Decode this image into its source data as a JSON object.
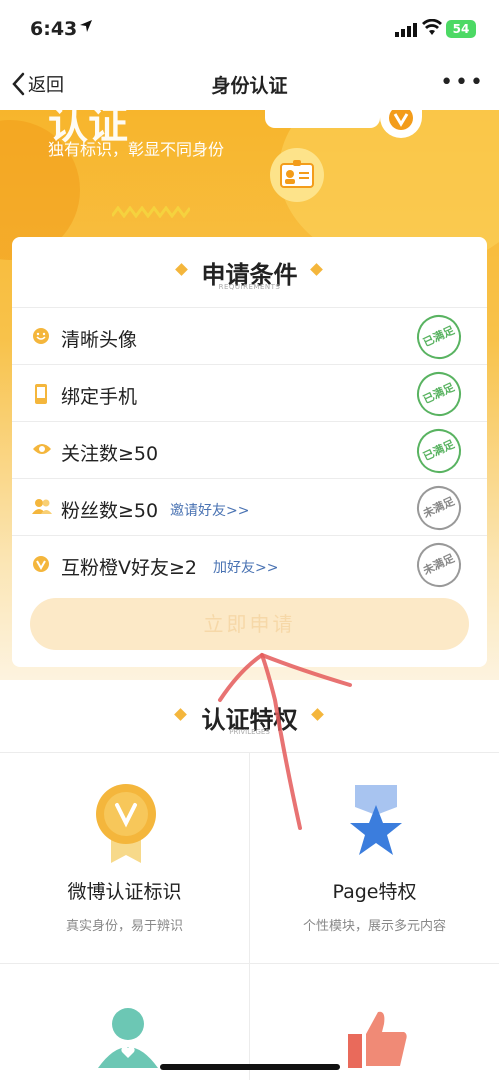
{
  "status": {
    "time": "6:43",
    "battery": "54"
  },
  "nav": {
    "back_label": "返回",
    "title": "身份认证"
  },
  "hero": {
    "big_text": "认证",
    "subtitle": "独有标识，彰显不同身份"
  },
  "conditions": {
    "title": "申请条件",
    "subtitle": "REQUIREMENTS",
    "rows": [
      {
        "label": "清晰头像",
        "link": "",
        "status": "已满足",
        "icon": "smile-icon"
      },
      {
        "label": "绑定手机",
        "link": "",
        "status": "已满足",
        "icon": "phone-icon"
      },
      {
        "label": "关注数≥50",
        "link": "",
        "status": "已满足",
        "icon": "eye-icon"
      },
      {
        "label": "粉丝数≥50",
        "link": "邀请好友>>",
        "status": "未满足",
        "icon": "fans-icon"
      },
      {
        "label": "互粉橙V好友≥2",
        "link": "加好友>>",
        "status": "未满足",
        "icon": "v-icon"
      }
    ],
    "apply_label": "立即申请"
  },
  "privileges": {
    "title": "认证特权",
    "subtitle": "PRIVILEGES",
    "items": [
      {
        "title": "微博认证标识",
        "sub": "真实身份，易于辨识",
        "icon": "v-medal-icon"
      },
      {
        "title": "Page特权",
        "sub": "个性模块，展示多元内容",
        "icon": "star-ribbon-icon"
      }
    ]
  },
  "colors": {
    "accent": "#f7b52c",
    "satisfied": "#59b361",
    "link": "#4a73b3"
  }
}
